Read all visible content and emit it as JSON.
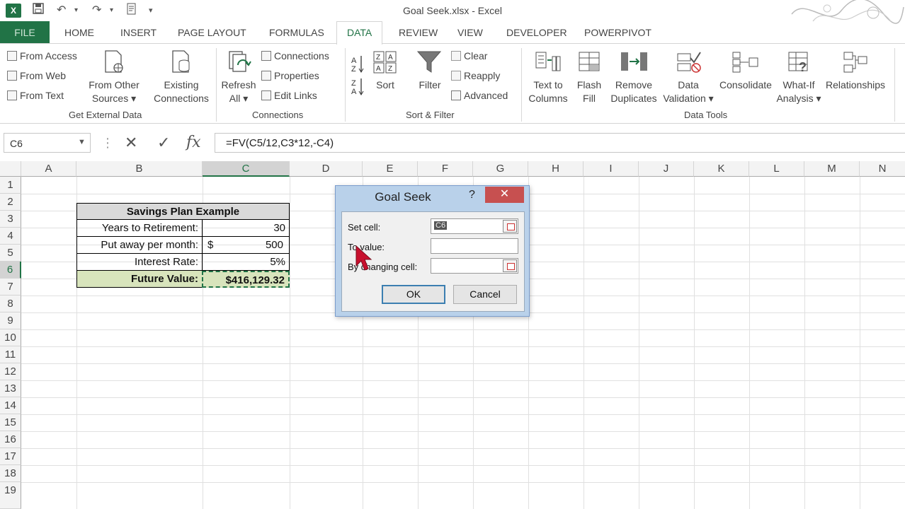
{
  "window": {
    "title": "Goal Seek.xlsx - Excel",
    "logo": "X"
  },
  "tabs": [
    {
      "label": "FILE"
    },
    {
      "label": "HOME"
    },
    {
      "label": "INSERT"
    },
    {
      "label": "PAGE LAYOUT"
    },
    {
      "label": "FORMULAS"
    },
    {
      "label": "DATA"
    },
    {
      "label": "REVIEW"
    },
    {
      "label": "VIEW"
    },
    {
      "label": "DEVELOPER"
    },
    {
      "label": "POWERPIVOT"
    }
  ],
  "ribbon": {
    "get_external": {
      "from_access": "From Access",
      "from_web": "From Web",
      "from_text": "From Text",
      "other_1": "From Other",
      "other_2": "Sources ▾",
      "existing_1": "Existing",
      "existing_2": "Connections",
      "label": "Get External Data"
    },
    "connections": {
      "refresh_1": "Refresh",
      "refresh_2": "All ▾",
      "connections": "Connections",
      "properties": "Properties",
      "edit_links": "Edit Links",
      "label": "Connections"
    },
    "sort_filter": {
      "sort": "Sort",
      "filter": "Filter",
      "clear": "Clear",
      "reapply": "Reapply",
      "advanced": "Advanced",
      "label": "Sort & Filter"
    },
    "data_tools": {
      "ttc_1": "Text to",
      "ttc_2": "Columns",
      "flash_1": "Flash",
      "flash_2": "Fill",
      "remove_1": "Remove",
      "remove_2": "Duplicates",
      "valid_1": "Data",
      "valid_2": "Validation ▾",
      "consolidate": "Consolidate",
      "whatif_1": "What-If",
      "whatif_2": "Analysis ▾",
      "relationships": "Relationships",
      "label": "Data Tools"
    }
  },
  "formula_bar": {
    "name_box": "C6",
    "cancel": "✕",
    "enter": "✓",
    "fx": "fx",
    "formula": "=FV(C5/12,C3*12,-C4)"
  },
  "columns": [
    "A",
    "B",
    "C",
    "D",
    "E",
    "F",
    "G",
    "H",
    "I",
    "J",
    "K",
    "L",
    "M",
    "N"
  ],
  "rows": [
    "1",
    "2",
    "3",
    "4",
    "5",
    "6",
    "7",
    "8",
    "9",
    "10",
    "11",
    "12",
    "13",
    "14",
    "15",
    "16",
    "17",
    "18",
    "19"
  ],
  "table": {
    "title": "Savings Plan Example",
    "years_label": "Years to Retirement:",
    "years_value": "30",
    "monthly_label": "Put away per month:",
    "monthly_currency": "$",
    "monthly_value": "500",
    "rate_label": "Interest Rate:",
    "rate_value": "5%",
    "fv_label": "Future Value:",
    "fv_value": "$416,129.32"
  },
  "dialog": {
    "title": "Goal Seek",
    "help": "?",
    "close": "✕",
    "set_cell_label": "Set cell:",
    "set_cell_value": "C6",
    "to_value_label": "To value:",
    "to_value_value": "",
    "changing_label": "By changing cell:",
    "changing_value": "",
    "ok": "OK",
    "cancel": "Cancel"
  },
  "colors": {
    "excel_green": "#217346",
    "header_gray": "#f3f3f3",
    "dialog_frame": "#b9d1ea",
    "close_red": "#c75050",
    "fv_fill": "#d8e4bc"
  }
}
